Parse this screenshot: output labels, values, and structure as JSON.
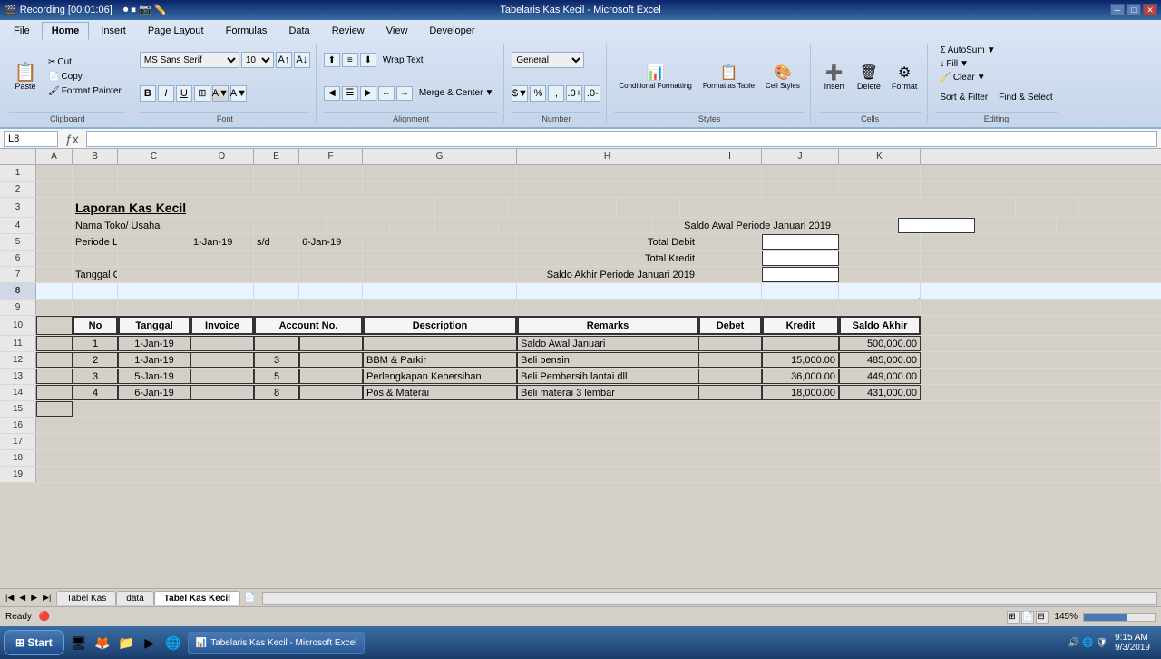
{
  "titlebar": {
    "recording": "Recording [00:01:06]",
    "title": "Tabelaris Kas Kecil - Microsoft Excel",
    "minimize": "─",
    "maximize": "□",
    "close": "✕"
  },
  "menu": {
    "items": [
      "File",
      "Home",
      "Insert",
      "Page Layout",
      "Formulas",
      "Data",
      "Review",
      "View",
      "Developer"
    ]
  },
  "ribbon": {
    "clipboard_label": "Clipboard",
    "font_label": "Font",
    "alignment_label": "Alignment",
    "number_label": "Number",
    "styles_label": "Styles",
    "cells_label": "Cells",
    "editing_label": "Editing",
    "paste_label": "Paste",
    "cut_label": "Cut",
    "copy_label": "Copy",
    "format_painter_label": "Format Painter",
    "font_name": "MS Sans Serif",
    "font_size": "10",
    "bold": "B",
    "italic": "I",
    "underline": "U",
    "wrap_text": "Wrap Text",
    "merge_center": "Merge & Center",
    "general": "General",
    "conditional_formatting": "Conditional Formatting",
    "format_as_table": "Format as Table",
    "cell_styles": "Cell Styles",
    "insert": "Insert",
    "delete": "Delete",
    "format": "Format",
    "autosum": "AutoSum",
    "fill": "Fill",
    "clear": "Clear",
    "sort_filter": "Sort & Filter",
    "find_select": "Find & Select"
  },
  "formula_bar": {
    "cell_ref": "L8",
    "formula": ""
  },
  "columns": [
    "A",
    "B",
    "C",
    "D",
    "E",
    "F",
    "G",
    "H",
    "I",
    "J",
    "K"
  ],
  "sheet": {
    "rows": [
      {
        "num": 1,
        "cells": {}
      },
      {
        "num": 2,
        "cells": {}
      },
      {
        "num": 3,
        "cells": {
          "B": "Laporan Kas Kecil"
        }
      },
      {
        "num": 4,
        "cells": {
          "B": "Nama Toko/ Usaha",
          "H": "Saldo Awal Periode Januari 2019"
        }
      },
      {
        "num": 5,
        "cells": {
          "B": "Periode Laporan :",
          "D": "1-Jan-19",
          "E": "s/d",
          "F": "6-Jan-19",
          "H": "Total Debit"
        }
      },
      {
        "num": 6,
        "cells": {
          "H": "Total Kredit"
        }
      },
      {
        "num": 7,
        "cells": {
          "B": "Tanggal Cetak :",
          "H": "Saldo Akhir Periode Januari 2019"
        }
      },
      {
        "num": 8,
        "cells": {}
      },
      {
        "num": 9,
        "cells": {}
      },
      {
        "num": 10,
        "cells": {
          "B": "No",
          "C": "Tanggal",
          "D": "Invoice",
          "E": "Account No.",
          "G": "Description",
          "H": "Remarks",
          "I": "Debet",
          "J": "Kredit",
          "K": "Saldo Akhir"
        }
      },
      {
        "num": 11,
        "cells": {
          "B": "1",
          "C": "1-Jan-19",
          "H": "Saldo Awal Januari",
          "K": "500,000.00"
        }
      },
      {
        "num": 12,
        "cells": {
          "B": "2",
          "C": "1-Jan-19",
          "E": "3",
          "G": "BBM & Parkir",
          "H": "Beli bensin",
          "J": "15,000.00",
          "K": "485,000.00"
        }
      },
      {
        "num": 13,
        "cells": {
          "B": "3",
          "C": "5-Jan-19",
          "E": "5",
          "G": "Perlengkapan Kebersihan",
          "H": "Beli Pembersih lantai dll",
          "J": "36,000.00",
          "K": "449,000.00"
        }
      },
      {
        "num": 14,
        "cells": {
          "B": "4",
          "C": "6-Jan-19",
          "E": "8",
          "G": "Pos & Materai",
          "H": "Beli materai 3 lembar",
          "J": "18,000.00",
          "K": "431,000.00"
        }
      },
      {
        "num": 15,
        "cells": {}
      },
      {
        "num": 16,
        "cells": {}
      },
      {
        "num": 17,
        "cells": {}
      },
      {
        "num": 18,
        "cells": {}
      },
      {
        "num": 19,
        "cells": {}
      }
    ]
  },
  "tabs": {
    "sheets": [
      "Tabel Kas",
      "data",
      "Tabel Kas Kecil"
    ],
    "active": "Tabel Kas Kecil"
  },
  "status_bar": {
    "ready": "Ready",
    "zoom": "145%",
    "date": "9/3/2019",
    "time": "9:15 AM"
  }
}
